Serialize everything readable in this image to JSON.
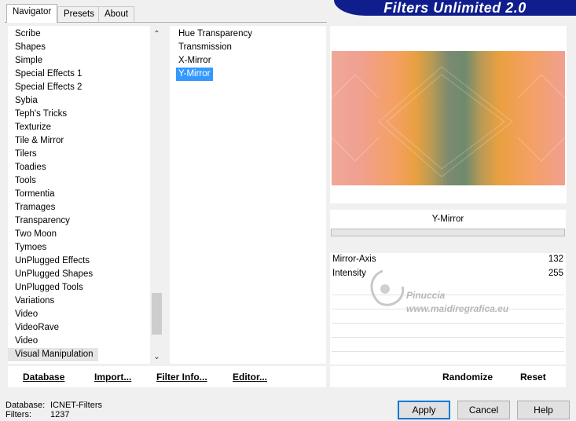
{
  "banner": {
    "title": "Filters Unlimited 2.0"
  },
  "tabs": [
    {
      "label": "Navigator",
      "active": true
    },
    {
      "label": "Presets",
      "active": false
    },
    {
      "label": "About",
      "active": false
    }
  ],
  "categories": [
    "Scribe",
    "Shapes",
    "Simple",
    "Special Effects 1",
    "Special Effects 2",
    "Sybia",
    "Teph's Tricks",
    "Texturize",
    "Tile & Mirror",
    "Tilers",
    "Toadies",
    "Tools",
    "Tormentia",
    "Tramages",
    "Transparency",
    "Two Moon",
    "Tymoes",
    "UnPlugged Effects",
    "UnPlugged Shapes",
    "UnPlugged Tools",
    "Variations",
    "Video",
    "VideoRave",
    "Video",
    "Visual Manipulation"
  ],
  "selected_category": "Visual Manipulation",
  "filters": [
    "Hue Transparency",
    "Transmission",
    "X-Mirror",
    "Y-Mirror"
  ],
  "selected_filter": "Y-Mirror",
  "filter_panel": {
    "title": "Y-Mirror",
    "params": [
      {
        "label": "Mirror-Axis",
        "value": "132"
      },
      {
        "label": "Intensity",
        "value": "255"
      }
    ]
  },
  "left_actions": {
    "database": "Database",
    "import": "Import...",
    "filter_info": "Filter Info...",
    "editor": "Editor..."
  },
  "right_actions": {
    "randomize": "Randomize",
    "reset": "Reset"
  },
  "status": {
    "database_label": "Database:",
    "database_value": "ICNET-Filters",
    "filters_label": "Filters:",
    "filters_value": "1237"
  },
  "buttons": {
    "apply": "Apply",
    "cancel": "Cancel",
    "help": "Help"
  },
  "watermark": {
    "line1": "Pinuccia",
    "line2": "www.maidiregrafica.eu"
  },
  "colors": {
    "banner": "#0f1e8c",
    "selection": "#3399ff",
    "default_button_border": "#0078d7"
  }
}
